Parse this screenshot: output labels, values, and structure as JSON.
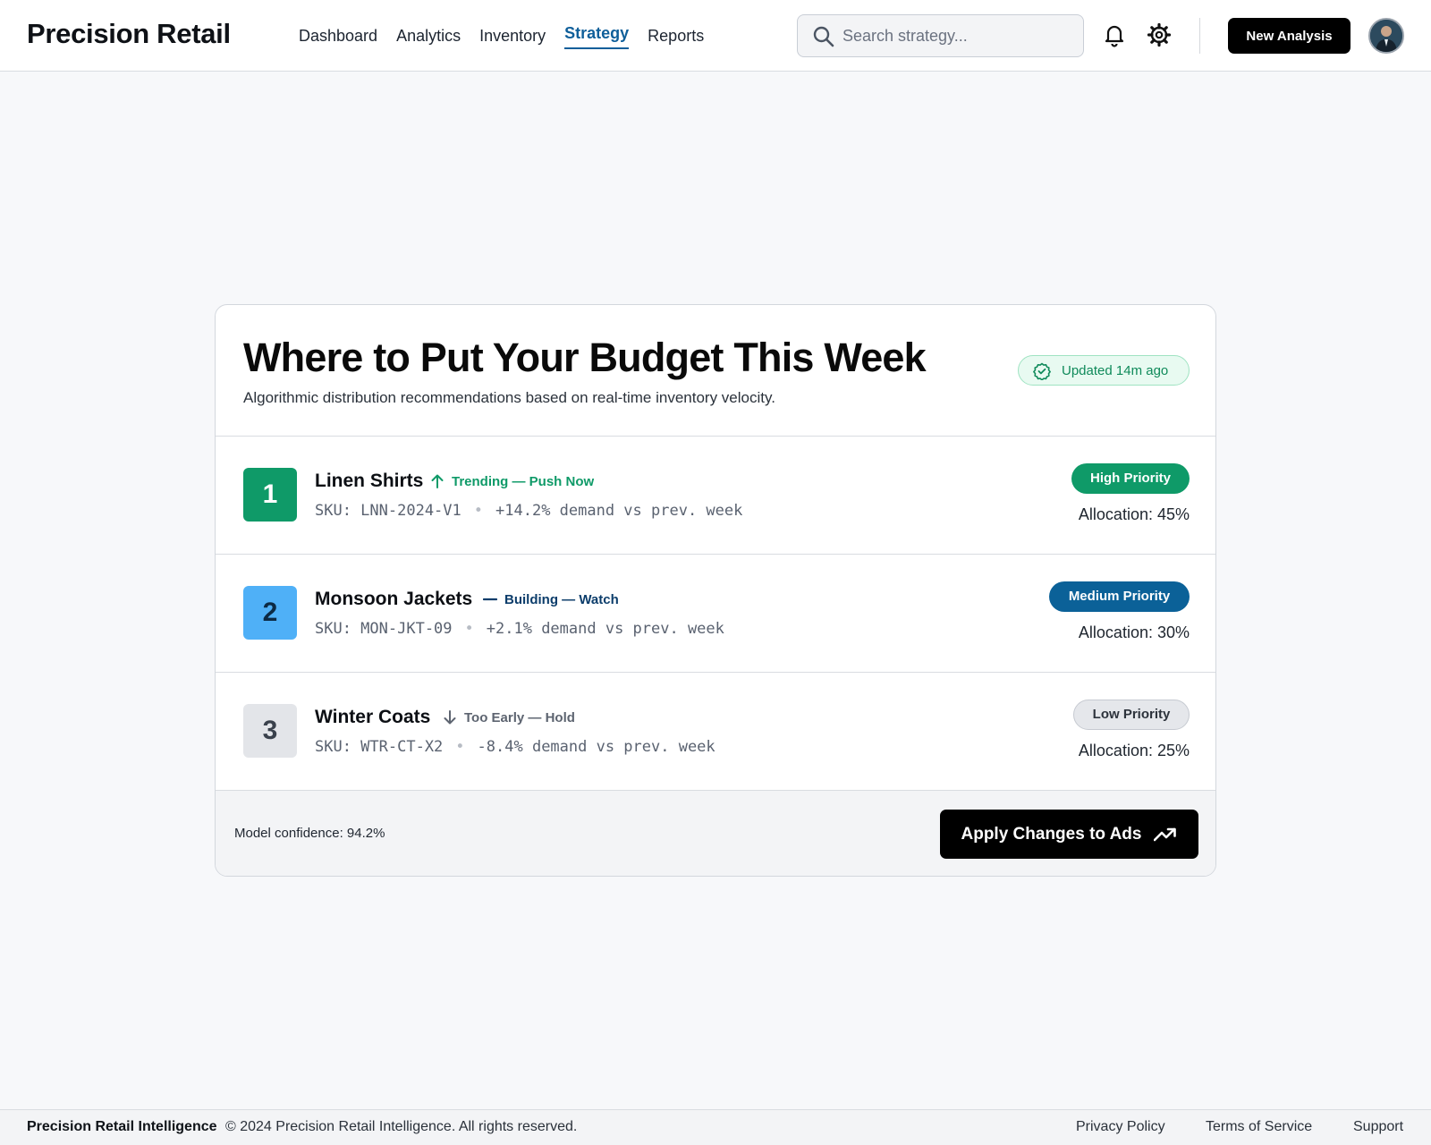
{
  "header": {
    "brand": "Precision Retail",
    "nav": [
      {
        "label": "Dashboard",
        "active": false
      },
      {
        "label": "Analytics",
        "active": false
      },
      {
        "label": "Inventory",
        "active": false
      },
      {
        "label": "Strategy",
        "active": true
      },
      {
        "label": "Reports",
        "active": false
      }
    ],
    "search_placeholder": "Search strategy...",
    "icons": {
      "search": "search-icon",
      "notifications": "bell-icon",
      "settings": "gear-icon"
    },
    "new_button": "New Analysis"
  },
  "card": {
    "title": "Where to Put Your Budget This Week",
    "subtitle": "Algorithmic distribution recommendations based on real-time inventory velocity.",
    "updated": "Updated 14m ago",
    "rows": [
      {
        "rank": "1",
        "name": "Linen Shirts",
        "trend": "Trending — Push Now",
        "trend_icon": "arrow-up-icon",
        "sku": "SKU: LNN-2024-V1",
        "demand": "+14.2% demand vs prev. week",
        "priority": "High Priority",
        "allocation": "Allocation: 45%"
      },
      {
        "rank": "2",
        "name": "Monsoon Jackets",
        "trend": "Building — Watch",
        "trend_icon": "dash-icon",
        "sku": "SKU: MON-JKT-09",
        "demand": "+2.1% demand vs prev. week",
        "priority": "Medium Priority",
        "allocation": "Allocation: 30%"
      },
      {
        "rank": "3",
        "name": "Winter Coats",
        "trend": "Too Early — Hold",
        "trend_icon": "arrow-down-icon",
        "sku": "SKU: WTR-CT-X2",
        "demand": "-8.4% demand vs prev. week",
        "priority": "Low Priority",
        "allocation": "Allocation: 25%"
      }
    ],
    "confidence": "Model confidence: 94.2%",
    "apply_button": "Apply Changes to Ads"
  },
  "colors": {
    "accent": "#0f5f9a",
    "high": "#0f9a68",
    "medium": "#0b6198",
    "low": "#e5e7eb",
    "rank2": "#4fb0f7"
  },
  "footer": {
    "brand": "Precision Retail Intelligence",
    "copyright": "© 2024 Precision Retail Intelligence. All rights reserved.",
    "links": [
      "Privacy Policy",
      "Terms of Service",
      "Support"
    ]
  }
}
